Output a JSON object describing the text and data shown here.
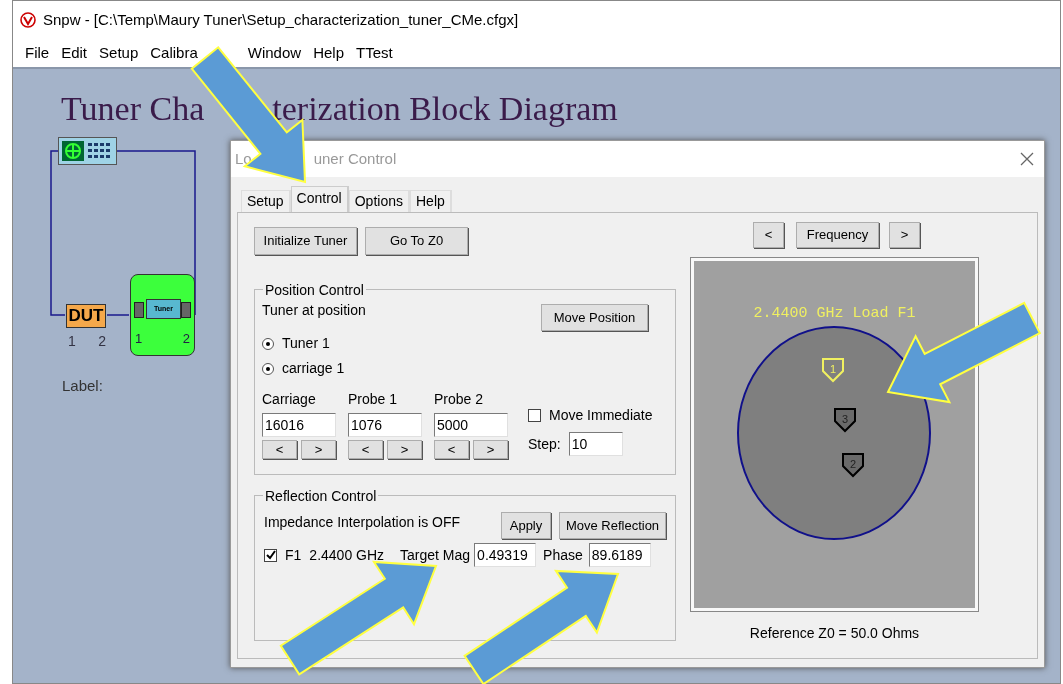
{
  "window": {
    "title": "Snpw - [C:\\Temp\\Maury Tuner\\Setup_characterization_tuner_CMe.cfgx]"
  },
  "menu": [
    "File",
    "Edit",
    "Setup",
    "Calibra",
    "Window",
    "Help",
    "TTest"
  ],
  "diagram": {
    "heading_parts": [
      "Tuner Cha",
      "terization Block Diagram"
    ],
    "dut": {
      "label": "DUT",
      "ports": [
        "1",
        "2"
      ]
    },
    "tuner": {
      "label": "Tuner",
      "ports": [
        "1",
        "2"
      ]
    },
    "caption": "Label:"
  },
  "dialog": {
    "title_parts": [
      "Lo",
      "uner Control"
    ],
    "tabs": [
      {
        "label": "Setup",
        "selected": false
      },
      {
        "label": "Control",
        "selected": true
      },
      {
        "label": "Options",
        "selected": false
      },
      {
        "label": "Help",
        "selected": false
      }
    ],
    "top_buttons": [
      "Initialize Tuner",
      "Go To Z0"
    ],
    "position_control": {
      "legend": "Position Control",
      "status": "Tuner at position",
      "move_button": "Move Position",
      "radios": [
        {
          "label": "Tuner 1",
          "selected": true
        },
        {
          "label": "carriage 1",
          "selected": true
        }
      ],
      "fields": [
        {
          "label": "Carriage",
          "value": "16016",
          "prev": "<",
          "next": ">"
        },
        {
          "label": "Probe 1",
          "value": "1076",
          "prev": "<",
          "next": ">"
        },
        {
          "label": "Probe 2",
          "value": "5000",
          "prev": "<",
          "next": ">"
        }
      ],
      "move_immediate": {
        "label": "Move Immediate",
        "checked": false
      },
      "step": {
        "label": "Step:",
        "value": "10"
      }
    },
    "reflection_control": {
      "legend": "Reflection Control",
      "status": "Impedance Interpolation is OFF",
      "buttons": [
        "Apply",
        "Move Reflection"
      ],
      "f1": {
        "label": "F1",
        "checked": true
      },
      "frequency": "2.4400 GHz",
      "mag": {
        "label": "Target Mag",
        "value": "0.49319"
      },
      "phase": {
        "label": "Phase",
        "value": "89.6189"
      }
    },
    "plot": {
      "prev": "<",
      "frequency_button": "Frequency",
      "next": ">",
      "title": "2.4400 GHz Load F1",
      "markers": [
        {
          "label": "1",
          "selected": true
        },
        {
          "label": "3",
          "selected": false
        },
        {
          "label": "2",
          "selected": false
        }
      ],
      "reference": "Reference Z0 = 50.0 Ohms"
    }
  }
}
